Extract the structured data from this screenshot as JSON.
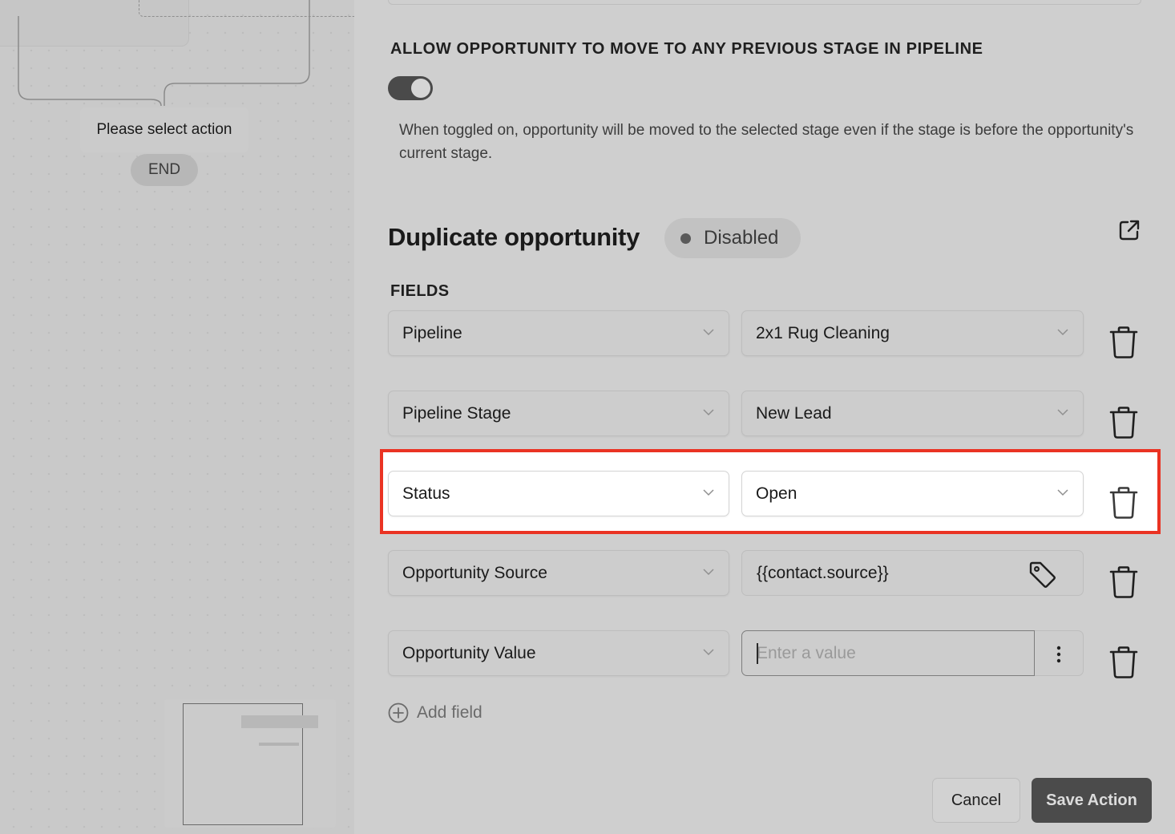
{
  "canvas": {
    "action_node_label": "Please select action",
    "end_label": "END"
  },
  "stage_setting": {
    "heading": "ALLOW OPPORTUNITY TO MOVE TO ANY PREVIOUS STAGE IN PIPELINE",
    "toggle_on": true,
    "help_text": "When toggled on, opportunity will be moved to the selected stage even if the stage is before the opportunity's current stage."
  },
  "action": {
    "title": "Duplicate opportunity",
    "status": "Disabled",
    "external_link_icon": "external-link-icon"
  },
  "fields_section": {
    "label": "FIELDS",
    "rows": [
      {
        "field": "Pipeline",
        "value": "2x1 Rug Cleaning"
      },
      {
        "field": "Pipeline Stage",
        "value": "New Lead"
      },
      {
        "field": "Status",
        "value": "Open"
      },
      {
        "field": "Opportunity Source",
        "value": "{{contact.source}}"
      },
      {
        "field": "Opportunity Value",
        "value": "",
        "placeholder": "Enter a value"
      }
    ],
    "add_field_label": "Add field"
  },
  "footer": {
    "cancel_label": "Cancel",
    "save_label": "Save Action"
  },
  "colors": {
    "highlight_border": "#ea3323",
    "primary_button": "#4b4b4b"
  }
}
